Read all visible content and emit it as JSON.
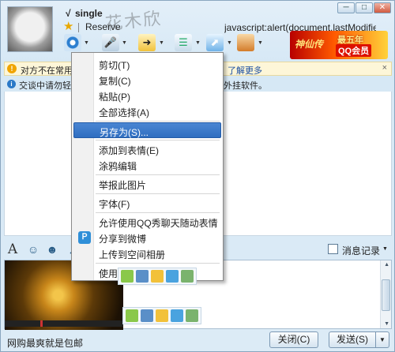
{
  "header": {
    "check_mark": "√",
    "nickname": "single",
    "signature": "Reserve",
    "watermark": "花木欣",
    "window_title": "javascript:alert(document.lastModifie..."
  },
  "window_controls": {
    "minimize": "─",
    "maximize": "□",
    "close": "✕"
  },
  "toolbar": {
    "icons": [
      "video-call-icon",
      "voice-call-icon",
      "transfer-file-icon",
      "create-group-icon",
      "remote-assist-icon",
      "app-box-icon"
    ],
    "dropdown_glyph": "▼"
  },
  "ad": {
    "logo_text": "神仙传",
    "line1": "最五年",
    "line2": "QQ会员"
  },
  "notices": {
    "warning_text": "对方不在常用",
    "warning_more": "了解更多",
    "warning_close": "×",
    "info_text": "交谈中请勿轻",
    "info_right": "外挂软件。"
  },
  "context_menu": {
    "items": [
      {
        "label": "剪切(T)"
      },
      {
        "label": "复制(C)"
      },
      {
        "label": "粘贴(P)"
      },
      {
        "label": "全部选择(A)"
      },
      {
        "label": "另存为(S)..."
      },
      {
        "label": "添加到表情(E)"
      },
      {
        "label": "涂鸦编辑"
      },
      {
        "label": "举报此图片"
      },
      {
        "label": "字体(F)"
      },
      {
        "label": "允许使用QQ秀聊天随动表情"
      },
      {
        "label": "分享到微博"
      },
      {
        "label": "上传到空间相册"
      },
      {
        "label": "使用"
      }
    ],
    "selected_index": 4,
    "share_icon_glyph": "Ｐ"
  },
  "input_toolbar": {
    "font_glyph": "A",
    "history_label": "消息记录",
    "history_arrow": "▼"
  },
  "footer": {
    "status_text": "网购最爽就是包邮",
    "close_label": "关闭(C)",
    "send_label": "发送(S)",
    "send_arrow": "▼"
  }
}
